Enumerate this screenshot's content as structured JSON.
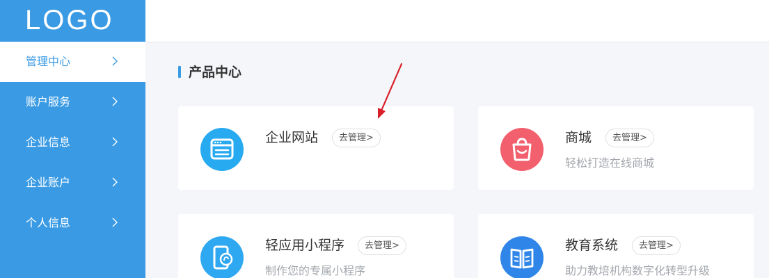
{
  "logo": {
    "text": "LOGO"
  },
  "sidebar": {
    "items": [
      {
        "label": "管理中心",
        "active": true
      },
      {
        "label": "账户服务"
      },
      {
        "label": "企业信息"
      },
      {
        "label": "企业账户"
      },
      {
        "label": "个人信息"
      }
    ]
  },
  "main": {
    "section_title": "产品中心",
    "products": [
      {
        "name": "企业网站",
        "manage_label": "去管理>",
        "description": "",
        "icon": "website-window-icon"
      },
      {
        "name": "商城",
        "manage_label": "去管理>",
        "description": "轻松打造在线商城",
        "icon": "shopping-bag-icon"
      },
      {
        "name": "轻应用小程序",
        "manage_label": "去管理>",
        "description": "制作您的专属小程序",
        "icon": "mini-program-icon"
      },
      {
        "name": "教育系统",
        "manage_label": "去管理>",
        "description": "助力教培机构数字化转型升级",
        "icon": "open-book-icon"
      }
    ]
  },
  "colors": {
    "sidebar": "#3a9be4",
    "accent": "#3a9be4",
    "annotation_arrow": "#d9202a",
    "website_icon": "#27aaf0",
    "mall_icon": "#f2606e",
    "mini_program_icon": "#2fa8f2",
    "education_icon": "#2f86e8"
  }
}
